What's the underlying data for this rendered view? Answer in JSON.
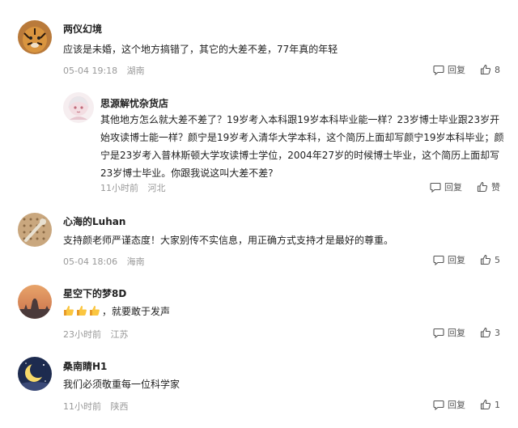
{
  "comments": [
    {
      "name": "两仪幻境",
      "text": "应该是未婚，这个地方搞错了，其它的大差不差，77年真的年轻",
      "time": "05-04 19:18",
      "location": "湖南",
      "reply_label": "回复",
      "like_count": "8",
      "avatar_icon": "tiger-avatar"
    },
    {
      "name": "思源解忧杂货店",
      "text_lines": [
        "其他地方怎么就大差不差了？19岁考入本科跟19岁本科毕业能一样？23岁博士毕业跟23岁开",
        "始攻读博士能一样？颜宁是19岁考入清华大学本科，这个简历上面却写颜宁19岁本科毕业；颜",
        "宁是23岁考入普林斯顿大学攻读博士学位，2004年27岁的时候博士毕业，这个简历上面却写",
        "23岁博士毕业。你跟我说这叫大差不差?"
      ],
      "time": "11小时前",
      "location": "河北",
      "reply_label": "回复",
      "like_label": "赞",
      "avatar_icon": "anime-girl-avatar"
    },
    {
      "name": "心海的Luhan",
      "text": "支持颜老师严谨态度！大家别传不实信息，用正确方式支持才是最好的尊重。",
      "time": "05-04 18:06",
      "location": "海南",
      "reply_label": "回复",
      "like_count": "5",
      "avatar_icon": "pegboard-avatar"
    },
    {
      "name": "星空下的梦8D",
      "emoji_icon": "thumbs-up-emoji",
      "text": "，就要敢于发声",
      "time": "23小时前",
      "location": "江苏",
      "reply_label": "回复",
      "like_count": "3",
      "avatar_icon": "sunset-avatar"
    },
    {
      "name": "桑南睛H1",
      "text": "我们必须敬重每一位科学家",
      "time": "11小时前",
      "location": "陕西",
      "reply_label": "回复",
      "like_count": "1",
      "avatar_icon": "moon-avatar"
    }
  ],
  "colors": {
    "text": "#222222",
    "meta": "#999999",
    "action": "#555555"
  }
}
